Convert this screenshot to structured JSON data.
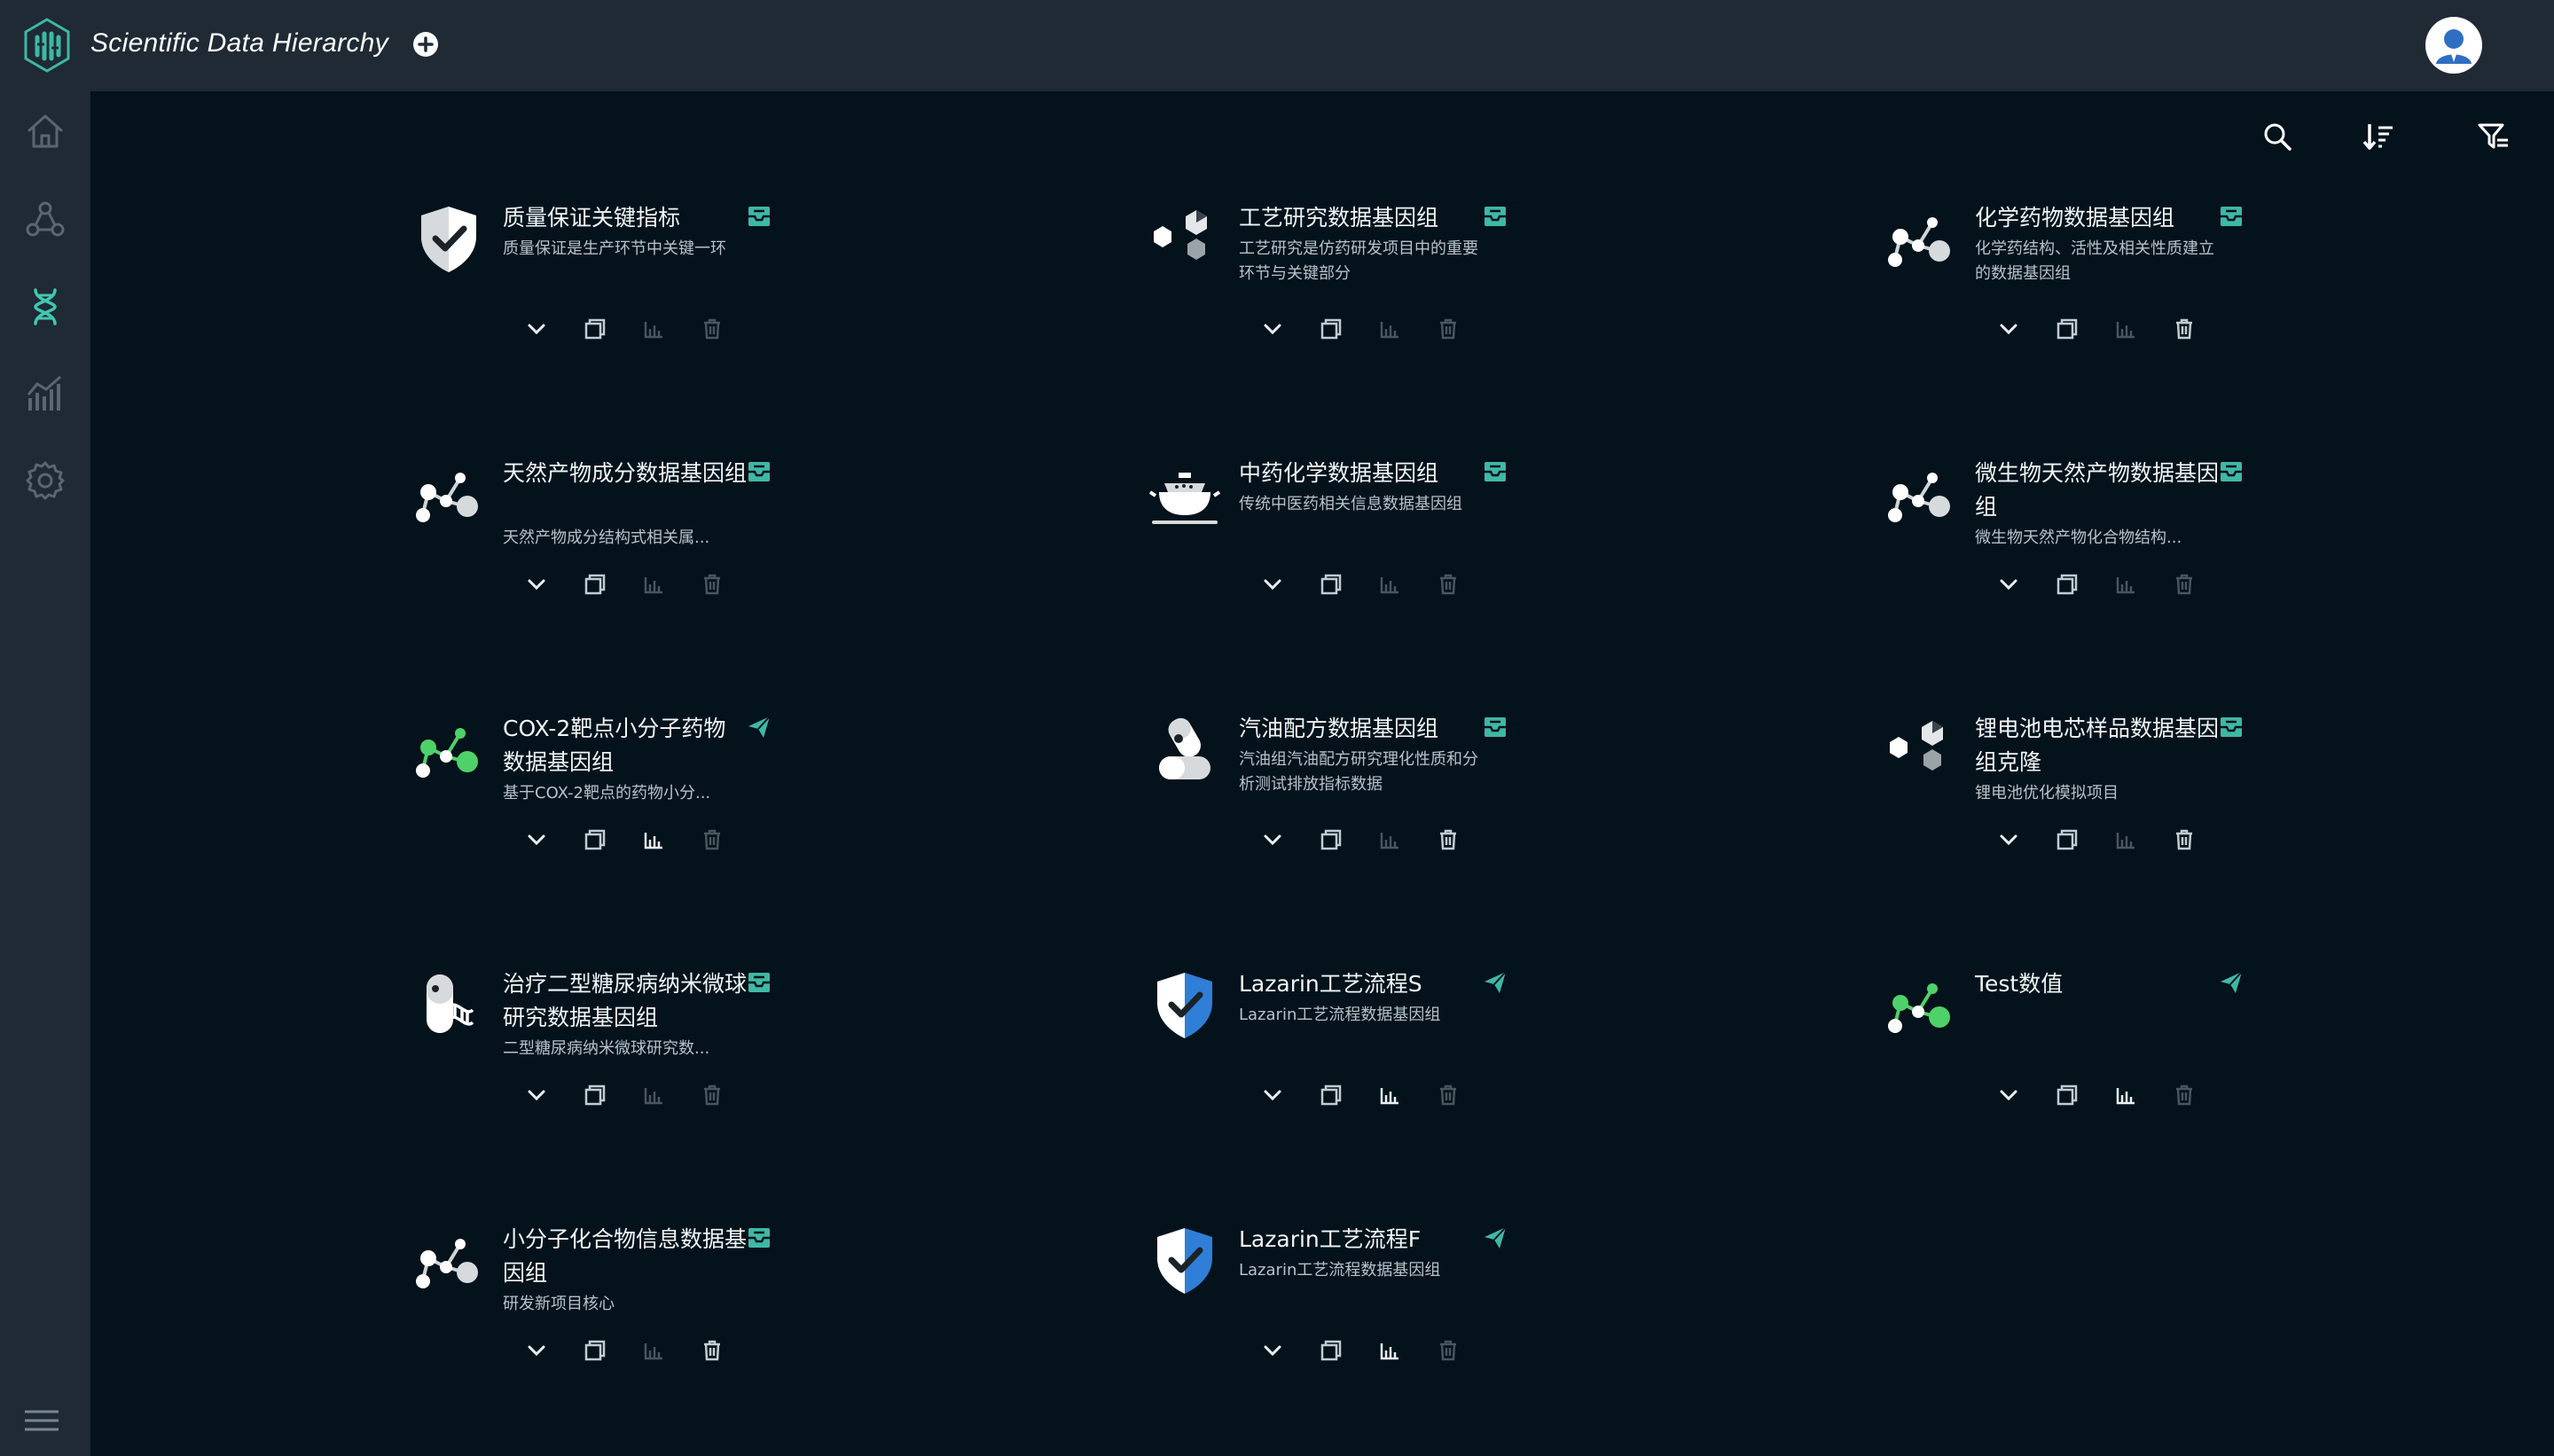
{
  "app": {
    "title": "Scientific Data Hierarchy"
  },
  "colors": {
    "background": "#03121b",
    "bar": "#1f2a35",
    "accent": "#3fb8a5",
    "active_icon": "#42c7b0",
    "muted_icon": "#5a6670",
    "white": "#ffffff",
    "blue_shield": "#2f7fd8",
    "green_node": "#4fd16a"
  },
  "sidebar": {
    "items": [
      {
        "name": "home-icon"
      },
      {
        "name": "network-icon"
      },
      {
        "name": "dna-icon"
      },
      {
        "name": "chart-icon"
      },
      {
        "name": "gear-icon"
      }
    ],
    "menu_icon": "menu-icon"
  },
  "toolbar": {
    "search_icon": "search-icon",
    "sort_icon": "sort-icon",
    "filter_icon": "filter-icon"
  },
  "cards": [
    {
      "title": "质量保证关键指标",
      "desc": "质量保证是生产环节中关键一环",
      "icon": "shield-icon",
      "status": "archive",
      "stats_active": false,
      "delete_active": false
    },
    {
      "title": "工艺研究数据基因组",
      "desc": "工艺研究是仿药研发项目中的重要环节与关键部分",
      "icon": "hexagons-icon",
      "status": "archive",
      "stats_active": false,
      "delete_active": false
    },
    {
      "title": "化学药物数据基因组",
      "desc": "化学药结构、活性及相关性质建立的数据基因组",
      "icon": "molecule-icon",
      "status": "archive",
      "stats_active": false,
      "delete_active": true
    },
    {
      "title": "天然产物成分数据基因组",
      "desc": "天然产物成分结构式相关属...",
      "icon": "molecule-icon",
      "status": "archive",
      "stats_active": false,
      "delete_active": false
    },
    {
      "title": "中药化学数据基因组",
      "desc": "传统中医药相关信息数据基因组",
      "icon": "herb-pot-icon",
      "status": "archive",
      "stats_active": false,
      "delete_active": false
    },
    {
      "title": "微生物天然产物数据基因组",
      "desc": "微生物天然产物化合物结构...",
      "icon": "molecule-icon",
      "status": "archive",
      "stats_active": false,
      "delete_active": false
    },
    {
      "title": "COX-2靶点小分子药物数据基因组",
      "desc": "基于COX-2靶点的药物小分...",
      "icon": "molecule-green-icon",
      "status": "published",
      "stats_active": true,
      "delete_active": false
    },
    {
      "title": "汽油配方数据基因组",
      "desc": "汽油组汽油配方研究理化性质和分析测试排放指标数据",
      "icon": "capsule-icon",
      "status": "archive",
      "stats_active": false,
      "delete_active": true
    },
    {
      "title": "锂电池电芯样品数据基因组克隆",
      "desc": "锂电池优化模拟项目",
      "icon": "hexagons-icon",
      "status": "archive",
      "stats_active": false,
      "delete_active": true
    },
    {
      "title": "治疗二型糖尿病纳米微球研究数据基因组",
      "desc": "二型糖尿病纳米微球研究数...",
      "icon": "capsule-dna-icon",
      "status": "archive",
      "stats_active": false,
      "delete_active": false
    },
    {
      "title": "Lazarin工艺流程S",
      "desc": "Lazarin工艺流程数据基因组",
      "icon": "shield-blue-icon",
      "status": "published",
      "stats_active": true,
      "delete_active": false
    },
    {
      "title": "Test数值",
      "desc": "",
      "icon": "molecule-green-icon",
      "status": "published",
      "stats_active": true,
      "delete_active": false
    },
    {
      "title": "小分子化合物信息数据基因组",
      "desc": "研发新项目核心",
      "icon": "molecule-icon",
      "status": "archive",
      "stats_active": false,
      "delete_active": true
    },
    {
      "title": "Lazarin工艺流程F",
      "desc": "Lazarin工艺流程数据基因组",
      "icon": "shield-blue-icon",
      "status": "published",
      "stats_active": true,
      "delete_active": false
    }
  ]
}
